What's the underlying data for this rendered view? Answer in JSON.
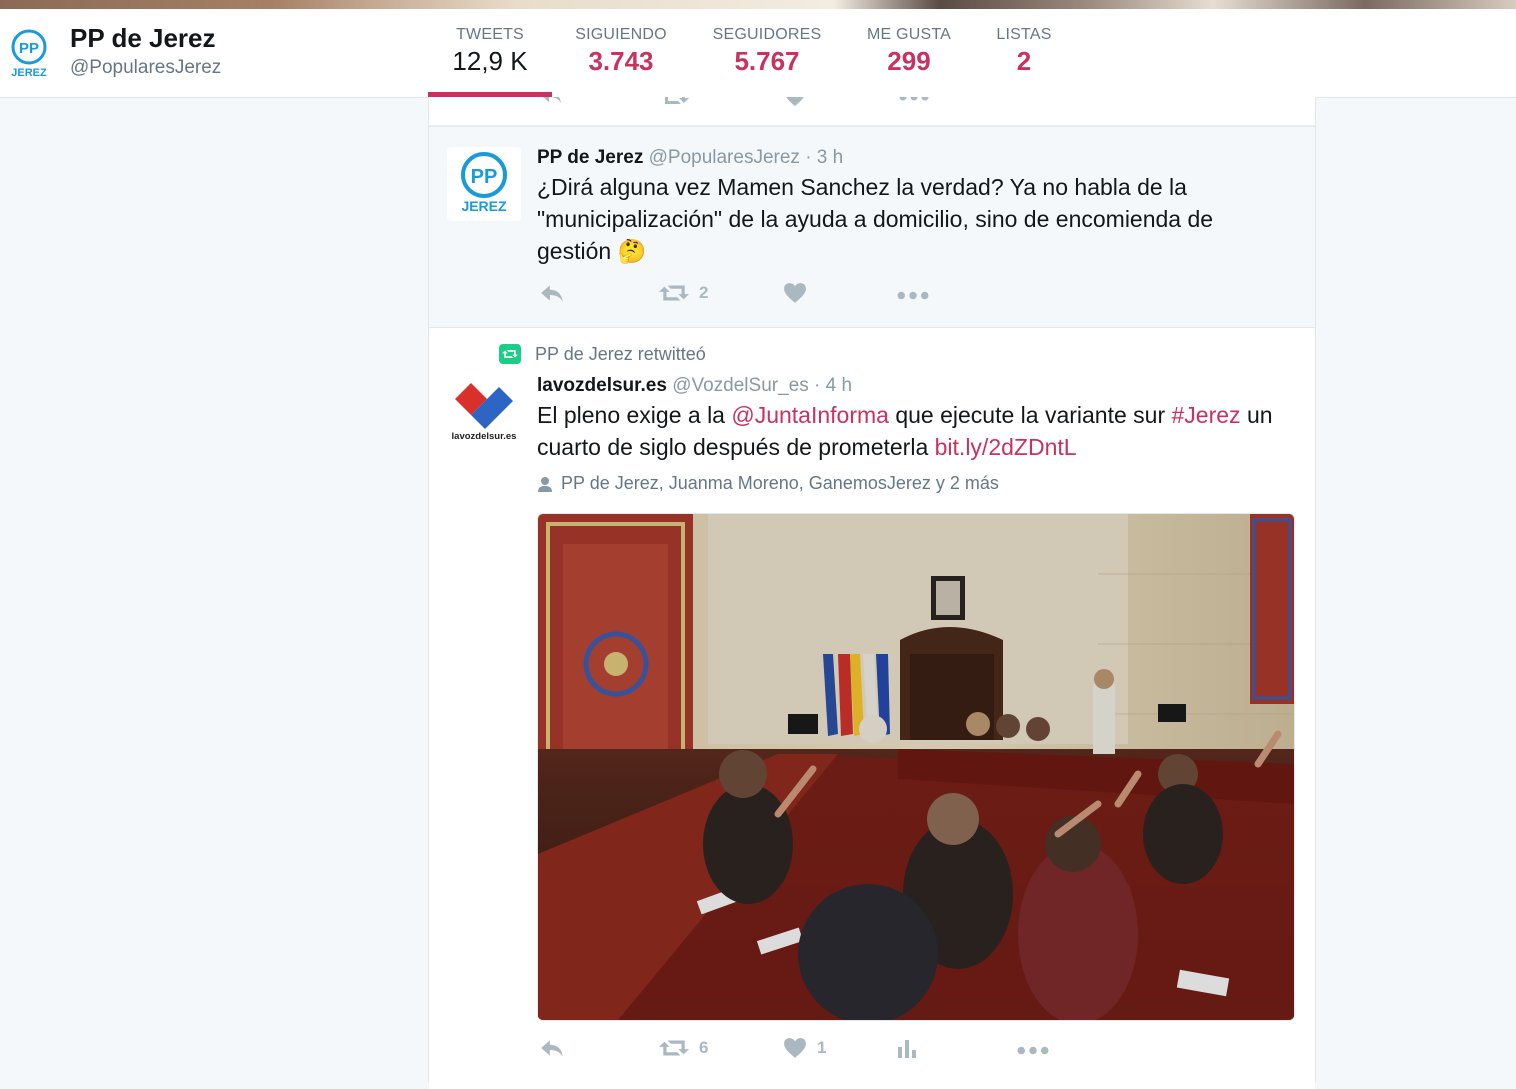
{
  "profile": {
    "name": "PP de Jerez",
    "handle": "@PopularesJerez",
    "avatar_text": "PP",
    "avatar_sub": "JEREZ"
  },
  "stats": [
    {
      "label": "TWEETS",
      "value": "12,9 K",
      "active": true
    },
    {
      "label": "SIGUIENDO",
      "value": "3.743"
    },
    {
      "label": "SEGUIDORES",
      "value": "5.767"
    },
    {
      "label": "ME GUSTA",
      "value": "299"
    },
    {
      "label": "LISTAS",
      "value": "2"
    }
  ],
  "colors": {
    "accent": "#c9325e",
    "muted": "#657786",
    "icon": "#aab8c2",
    "retweet_green": "#19cf86",
    "pp_blue": "#1a9bd7"
  },
  "tweets": [
    {
      "name": "PP de Jerez",
      "handle": "@PopularesJerez",
      "time": "· 3 h",
      "text": "¿Dirá alguna vez Mamen Sanchez la verdad? Ya no habla de la \"municipalización\" de la ayuda a domicilio, sino de encomienda de gestión",
      "emoji": "🤔",
      "retweets": "2",
      "icons": [
        "reply-icon",
        "retweet-icon",
        "heart-icon",
        "more-icon"
      ]
    },
    {
      "retweeted_by": "PP de Jerez retwitteó",
      "name": "lavozdelsur.es",
      "handle": "@VozdelSur_es",
      "time": "· 4 h",
      "text_before": "El pleno exige a la ",
      "mention": "@JuntaInforma",
      "text_middle": " que ejecute la variante sur ",
      "hashtag": "#Jerez",
      "text_after": " un cuarto de siglo después de prometerla ",
      "url": "bit.ly/2dZDntL",
      "tagged": "PP de Jerez, Juanma Moreno, GanemosJerez y 2 más",
      "avatar_caption": "lavozdelsur.es",
      "retweets": "6",
      "likes": "1",
      "icons": [
        "reply-icon",
        "retweet-icon",
        "heart-icon",
        "analytics-icon",
        "more-icon"
      ]
    }
  ]
}
